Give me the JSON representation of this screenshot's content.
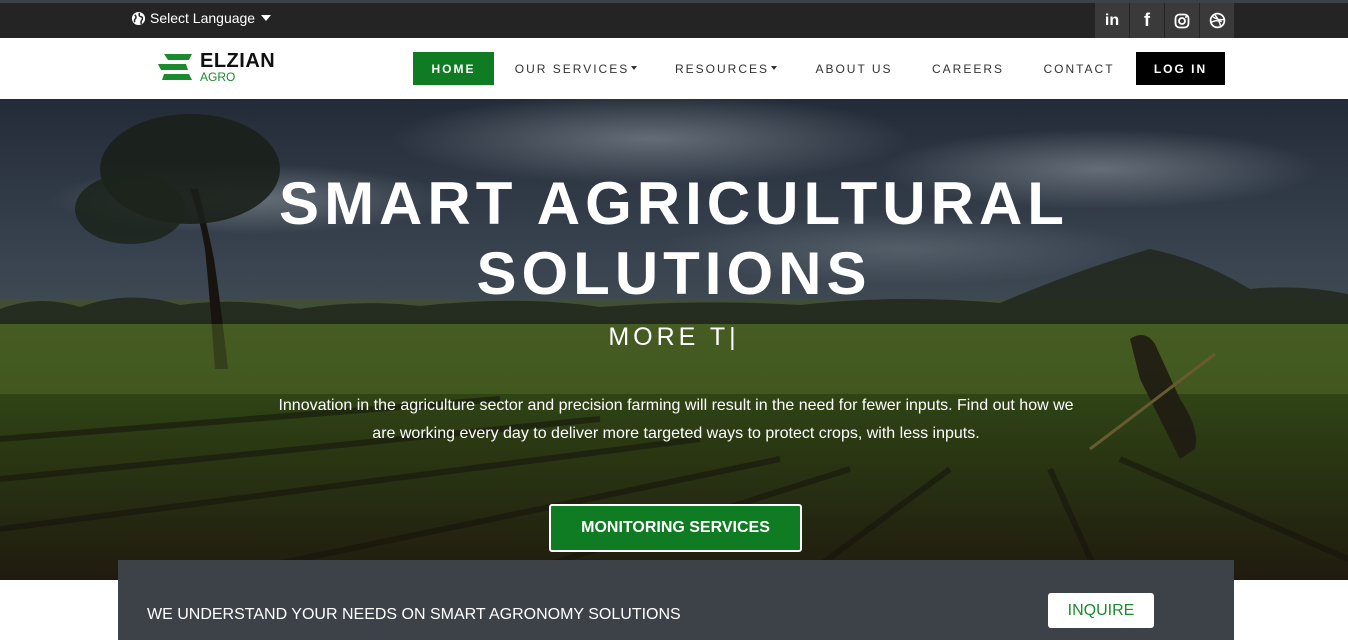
{
  "topbar": {
    "language_label": "Select Language",
    "social": [
      {
        "name": "linkedin-icon",
        "glyph": "in"
      },
      {
        "name": "facebook-icon",
        "glyph": "f"
      },
      {
        "name": "instagram-icon",
        "glyph": ""
      },
      {
        "name": "dribbble-icon",
        "glyph": ""
      }
    ]
  },
  "brand": {
    "name": "ELZIAN",
    "sub": "AGRO",
    "color": "#1b8a2f"
  },
  "nav": {
    "home": "HOME",
    "services": "OUR SERVICES",
    "resources": "RESOURCES",
    "about": "ABOUT US",
    "careers": "CAREERS",
    "contact": "CONTACT",
    "login": "LOG IN"
  },
  "hero": {
    "title_line1": "SMART AGRICULTURAL",
    "title_line2": "SOLUTIONS",
    "subtitle": "MORE T|",
    "description": "Innovation in the agriculture sector and precision farming will result in the need for fewer inputs. Find out how we are working every day to deliver more targeted ways to protect crops, with less inputs.",
    "button": "MONITORING SERVICES"
  },
  "cta": {
    "text": "WE UNDERSTAND YOUR NEEDS ON SMART AGRONOMY SOLUTIONS",
    "button": "INQUIRE"
  },
  "colors": {
    "accent_green": "#0f7b22",
    "topbar": "#242424",
    "cta_bg": "#3d4148"
  }
}
